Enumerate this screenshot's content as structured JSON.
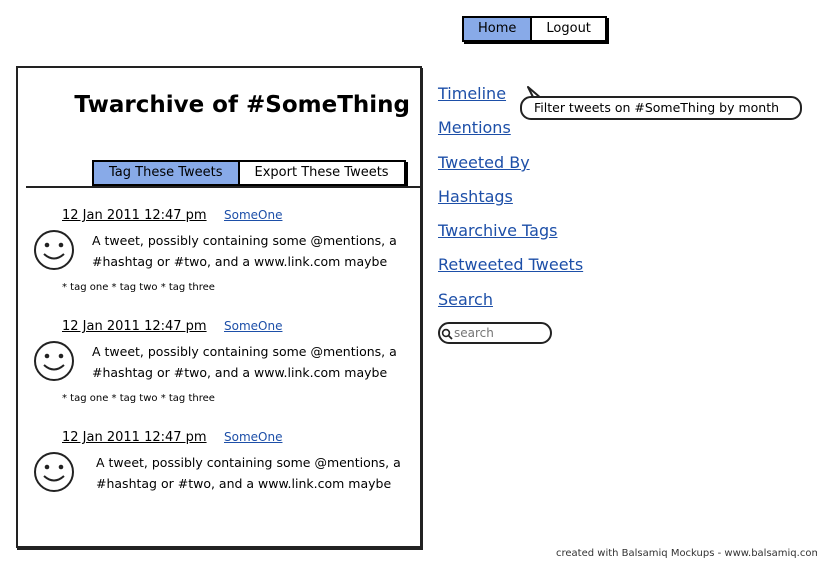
{
  "topnav": {
    "home": "Home",
    "logout": "Logout"
  },
  "main": {
    "title": "Twarchive of #SomeThing",
    "tabs": {
      "tag": "Tag These Tweets",
      "export": "Export These Tweets"
    },
    "tweets": [
      {
        "timestamp": "12 Jan 2011 12:47 pm",
        "author": "SomeOne",
        "line1": "A tweet, possibly containing some @mentions, a",
        "line2": "#hashtag or #two, and  a www.link.com maybe",
        "tags": "* tag one * tag two * tag three"
      },
      {
        "timestamp": "12 Jan 2011 12:47 pm",
        "author": "SomeOne",
        "line1": "A tweet, possibly containing some @mentions, a",
        "line2": "#hashtag or #two, and  a www.link.com maybe",
        "tags": "* tag one * tag two * tag three"
      },
      {
        "timestamp": "12 Jan 2011 12:47 pm",
        "author": "SomeOne",
        "line1": "A tweet, possibly containing some @mentions, a",
        "line2": "#hashtag or #two, and  a www.link.com maybe",
        "tags": ""
      }
    ]
  },
  "sidebar": {
    "links": [
      "Timeline",
      "Mentions",
      "Tweeted By",
      "Hashtags",
      "Twarchive Tags",
      "Retweeted Tweets",
      "Search"
    ],
    "callout": "Filter tweets on #SomeThing by month",
    "search_placeholder": "search"
  },
  "footer": {
    "credit": "created with Balsamiq Mockups - www.balsamiq.com"
  },
  "colors": {
    "accent": "#88aae8",
    "link": "#1d4fa8"
  }
}
